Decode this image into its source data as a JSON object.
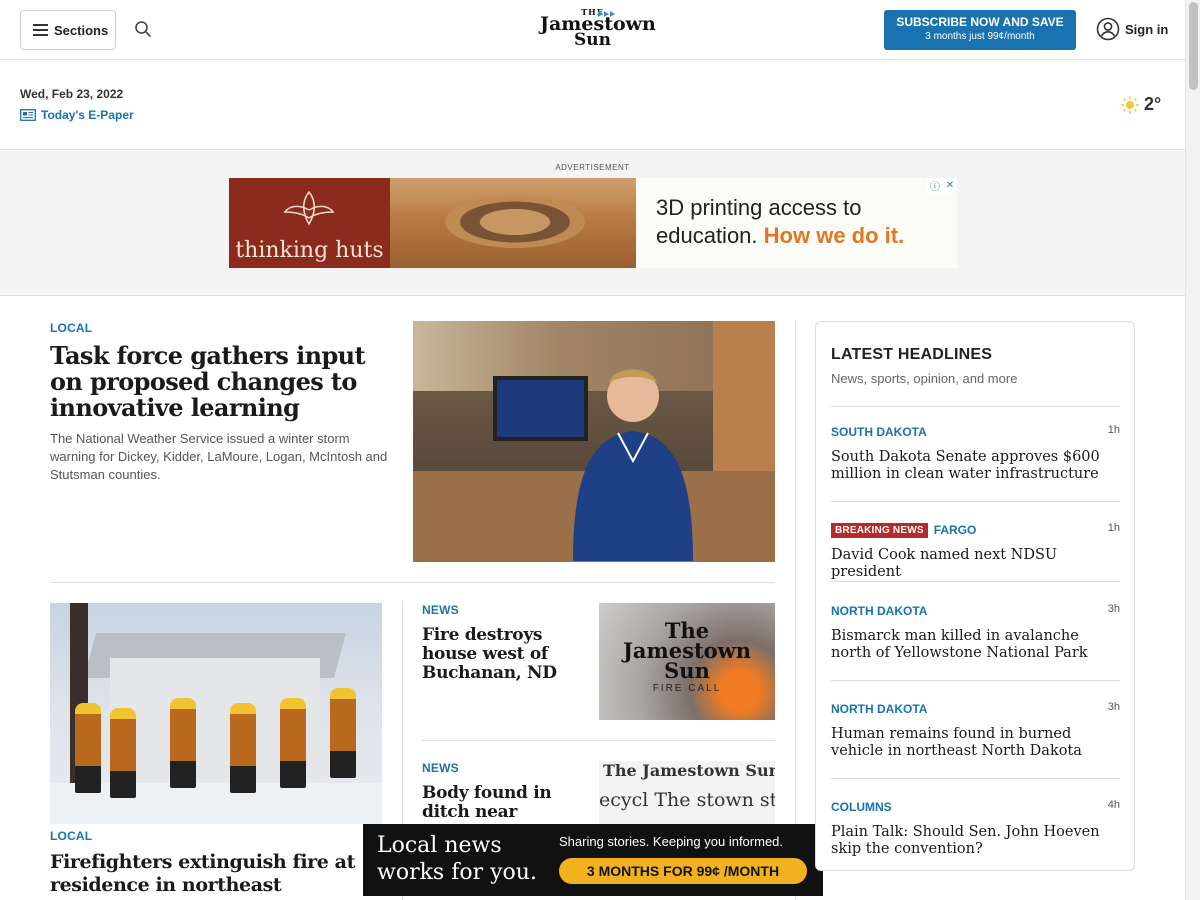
{
  "header": {
    "sections_label": "Sections",
    "logo": {
      "the": "THE",
      "line1": "Jamestown",
      "line2": "Sun"
    },
    "subscribe": {
      "line1": "SUBSCRIBE NOW AND SAVE",
      "line2": "3 months just 99¢/month"
    },
    "signin_label": "Sign in"
  },
  "datestrip": {
    "date": "Wed, Feb 23, 2022",
    "epaper_label": "Today's E-Paper",
    "temperature": "2°"
  },
  "ad_top": {
    "label": "ADVERTISEMENT",
    "brand": "thinking huts",
    "message_line1": "3D printing access to",
    "message_line2_prefix": "education.",
    "message_line2_highlight": "How we do it."
  },
  "main": {
    "lead": {
      "kicker": "LOCAL",
      "title": "Task force gathers input on proposed changes to innovative learning",
      "summary": "The National Weather Service issued a winter storm warning for Dickey, Kidder, LaMoure, Logan, McIntosh and Stutsman counties."
    },
    "story_fire": {
      "kicker": "LOCAL",
      "title": "Firefighters extinguish fire at residence in northeast Jamestown"
    },
    "story_news1": {
      "kicker": "NEWS",
      "title": "Fire destroys house west of Buchanan, ND",
      "thumb_line1": "The",
      "thumb_line2": "Jamestown",
      "thumb_line3": "Sun",
      "thumb_caption": "FIRE CALL"
    },
    "story_news2": {
      "kicker": "NEWS",
      "title": "Body found in ditch near",
      "thumb_row1": "The Jamestown Sun",
      "thumb_row2": "ecycl   The   stown   studi"
    }
  },
  "bottom_ad": {
    "left": "Local news works for you.",
    "tagline": "Sharing stories. Keeping you informed.",
    "cta": "3 MONTHS FOR 99¢ /MONTH"
  },
  "rail": {
    "title": "LATEST HEADLINES",
    "subtitle": "News, sports, opinion, and more",
    "items": [
      {
        "category": "SOUTH DAKOTA",
        "age": "1h",
        "title": "South Dakota Senate approves $600 million in clean water infrastructure",
        "badge": ""
      },
      {
        "category": "FARGO",
        "age": "1h",
        "title": "David Cook named next NDSU president",
        "badge": "BREAKING NEWS"
      },
      {
        "category": "NORTH DAKOTA",
        "age": "3h",
        "title": "Bismarck man killed in avalanche north of Yellowstone National Park",
        "badge": ""
      },
      {
        "category": "NORTH DAKOTA",
        "age": "3h",
        "title": "Human remains found in burned vehicle in northeast North Dakota",
        "badge": ""
      },
      {
        "category": "COLUMNS",
        "age": "4h",
        "title": "Plain Talk: Should Sen. John Hoeven skip the convention?",
        "badge": ""
      }
    ]
  },
  "colors": {
    "accent": "#1a72b0",
    "breaking": "#b52a2a",
    "cta": "#f2b21f"
  },
  "icons": [
    "hamburger-icon",
    "search-icon",
    "user-icon",
    "newspaper-icon",
    "sun-icon"
  ]
}
